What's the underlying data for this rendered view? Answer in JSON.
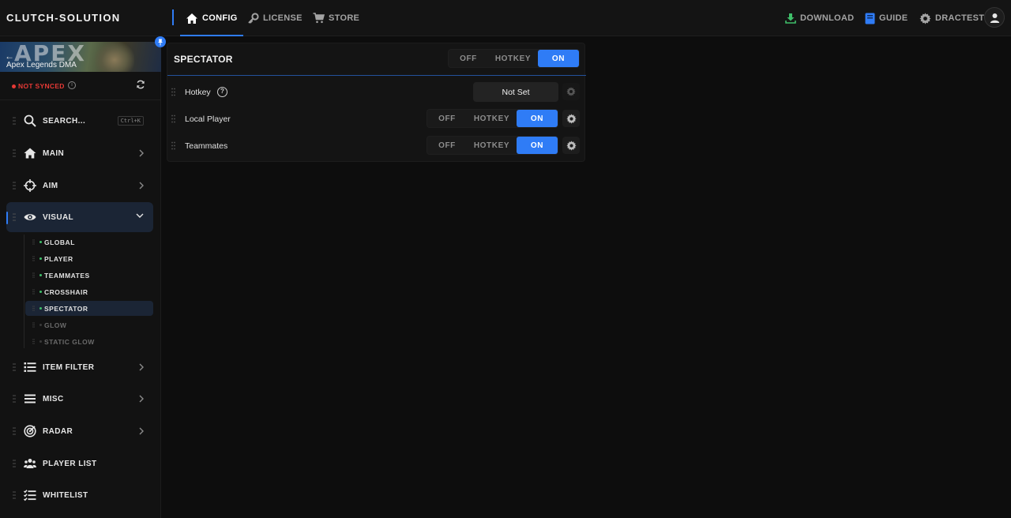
{
  "brand": "CLUTCH-SOLUTION",
  "nav": {
    "tabs": [
      {
        "label": "CONFIG",
        "icon": "home-icon",
        "active": true
      },
      {
        "label": "LICENSE",
        "icon": "key-icon",
        "active": false
      },
      {
        "label": "STORE",
        "icon": "cart-icon",
        "active": false
      }
    ],
    "right": [
      {
        "label": "DOWNLOAD",
        "icon": "download-icon"
      },
      {
        "label": "GUIDE",
        "icon": "book-icon"
      },
      {
        "label": "DRACTEST",
        "icon": "gear-icon"
      }
    ]
  },
  "sidebar": {
    "game_logo": "APEX",
    "game_name": "Apex Legends DMA",
    "sync_status": "NOT SYNCED",
    "search": {
      "label": "SEARCH...",
      "shortcut": "Ctrl+K"
    },
    "items": [
      {
        "label": "MAIN",
        "icon": "home-icon"
      },
      {
        "label": "AIM",
        "icon": "crosshair-icon"
      },
      {
        "label": "VISUAL",
        "icon": "eye-icon",
        "expanded": true
      },
      {
        "label": "ITEM FILTER",
        "icon": "list-icon"
      },
      {
        "label": "MISC",
        "icon": "menu-icon"
      },
      {
        "label": "RADAR",
        "icon": "radar-icon"
      },
      {
        "label": "PLAYER LIST",
        "icon": "users-icon"
      },
      {
        "label": "WHITELIST",
        "icon": "checklist-icon"
      }
    ],
    "visual_sub": [
      {
        "label": "GLOBAL",
        "enabled": true
      },
      {
        "label": "PLAYER",
        "enabled": true
      },
      {
        "label": "TEAMMATES",
        "enabled": true
      },
      {
        "label": "CROSSHAIR",
        "enabled": true
      },
      {
        "label": "SPECTATOR",
        "enabled": true,
        "selected": true
      },
      {
        "label": "GLOW",
        "enabled": false
      },
      {
        "label": "STATIC GLOW",
        "enabled": false
      }
    ]
  },
  "panel": {
    "title": "SPECTATOR",
    "mode_options": [
      "OFF",
      "HOTKEY",
      "ON"
    ],
    "mode_selected": "ON",
    "rows": [
      {
        "label": "Hotkey",
        "type": "hotkey",
        "value": "Not Set"
      },
      {
        "label": "Local Player",
        "type": "toggle",
        "options": [
          "OFF",
          "HOTKEY",
          "ON"
        ],
        "selected": "ON"
      },
      {
        "label": "Teammates",
        "type": "toggle",
        "options": [
          "OFF",
          "HOTKEY",
          "ON"
        ],
        "selected": "ON"
      }
    ]
  },
  "colors": {
    "accent": "#2f7cf6",
    "danger": "#e53935",
    "enabled_dot": "#3fbf6a",
    "download_icon": "#3fbf6a",
    "guide_icon": "#2f7cf6"
  }
}
